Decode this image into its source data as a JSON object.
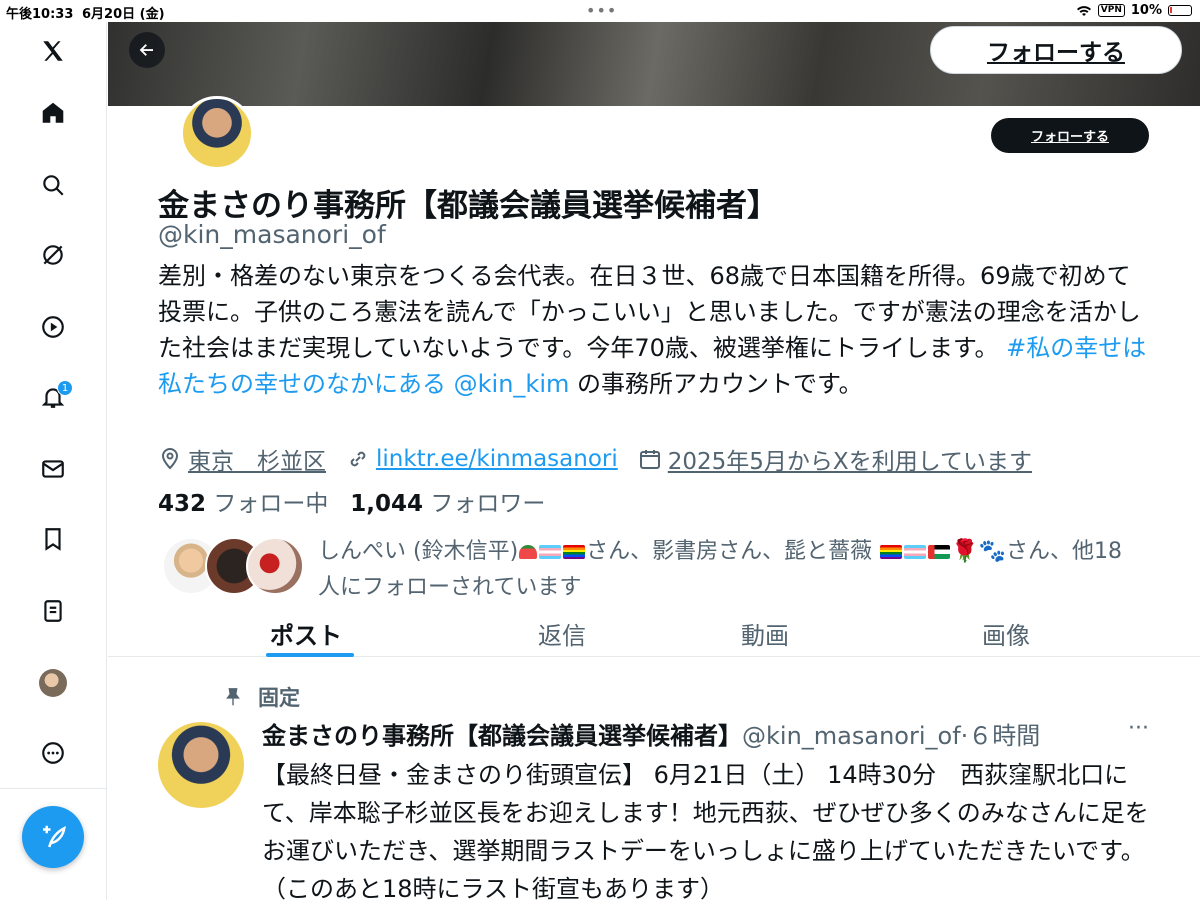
{
  "status": {
    "time": "午後10:33",
    "date": "6月20日 (金)",
    "vpn": "VPN",
    "battery": "10%"
  },
  "sidebar": {
    "notification_count": "1"
  },
  "header": {
    "follow_top": "フォローする"
  },
  "profile": {
    "follow_button": "フォローする",
    "name": "金まさのり事務所【都議会議員選挙候補者】",
    "handle": "@kin_masanori_of",
    "bio_text": "差別・格差のない東京をつくる会代表。在日３世、68歳で日本国籍を所得。69歳で初めて投票に。子供のころ憲法を読んで「かっこいい」と思いました。ですが憲法の理念を活かした社会はまだ実現していないようです。今年70歳、被選挙権にトライします。 ",
    "bio_hashtag": "#私の幸せは私たちの幸せのなかにある",
    "bio_mention": "@kin_kim",
    "bio_tail": " の事務所アカウントです。",
    "location": "東京　杉並区",
    "url": "linktr.ee/kinmasanori",
    "joined": "2025年5月からXを利用しています",
    "following_count": "432",
    "following_label": "フォロー中",
    "followers_count": "1,044",
    "followers_label": "フォロワー",
    "followed_by_pre": "しんぺい (鈴木信平)",
    "followed_by_mid": "さん、影書房さん、髭と薔薇",
    "followed_by_post": "さん、他18人にフォローされています"
  },
  "tabs": [
    "ポスト",
    "返信",
    "動画",
    "画像"
  ],
  "post": {
    "pinned_label": "固定",
    "author": "金まさのり事務所【都議会議員選挙候補者】",
    "handle": "@kin_masanori_of",
    "time": "·６時間",
    "more": "···",
    "body": "【最終日昼・金まさのり街頭宣伝】 6月21日（土） 14時30分　西荻窪駅北口にて、岸本聡子杉並区長をお迎えします！地元西荻、ぜひぜひ多くのみなさんに足をお運びいただき、選挙期間ラストデーをいっしょに盛り上げていただきたいです。（このあと18時にラスト街宣もあります）"
  },
  "colors": {
    "accent": "#1d9bf0",
    "text": "#0f1419",
    "muted": "#536471"
  }
}
